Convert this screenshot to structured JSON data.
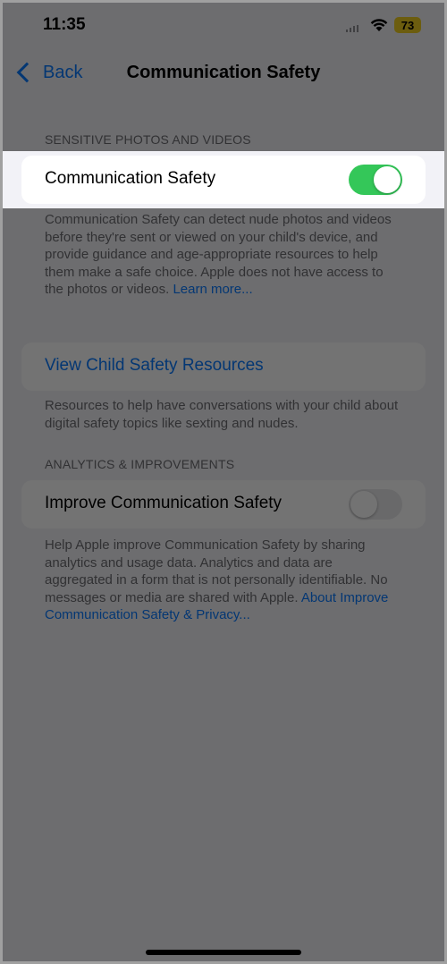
{
  "status_bar": {
    "time": "11:35",
    "battery": "73"
  },
  "nav": {
    "back_label": "Back",
    "title": "Communication Safety"
  },
  "sections": {
    "sensitive": {
      "header": "SENSITIVE PHOTOS AND VIDEOS",
      "toggle_label": "Communication Safety",
      "toggle_on": true,
      "footer_text": "Communication Safety can detect nude photos and videos before they're sent or viewed on your child's device, and provide guidance and age-appropriate resources to help them make a safe choice. Apple does not have access to the photos or videos.",
      "footer_link": "Learn more..."
    },
    "resources": {
      "link_label": "View Child Safety Resources",
      "footer_text": "Resources to help have conversations with your child about digital safety topics like sexting and nudes."
    },
    "analytics": {
      "header": "ANALYTICS & IMPROVEMENTS",
      "toggle_label": "Improve Communication Safety",
      "toggle_on": false,
      "footer_text": "Help Apple improve Communication Safety by sharing analytics and usage data. Analytics and data are aggregated in a form that is not personally identifiable. No messages or media are shared with Apple.",
      "footer_link": "About Improve Communication Safety & Privacy..."
    }
  },
  "colors": {
    "accent": "#0a7aff",
    "toggle_on": "#34c759",
    "battery": "#f0cf23"
  }
}
